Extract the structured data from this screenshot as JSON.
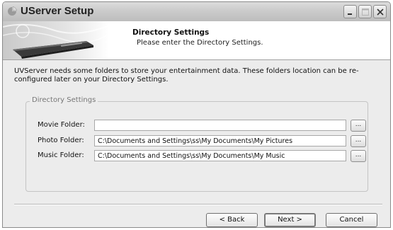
{
  "window": {
    "title": "UServer Setup"
  },
  "header": {
    "title": "Directory Settings",
    "subtitle": "Please enter the Directory Settings."
  },
  "intro": {
    "text": "UVServer needs some folders to store your entertainment data. These folders location can be re-configured later on your Directory Settings."
  },
  "group": {
    "legend": "Directory Settings",
    "fields": [
      {
        "label": "Movie Folder:",
        "value": "",
        "browse_label": "..."
      },
      {
        "label": "Photo Folder:",
        "value": "C:\\Documents and Settings\\ss\\My Documents\\My Pictures",
        "browse_label": "..."
      },
      {
        "label": "Music Folder:",
        "value": "C:\\Documents and Settings\\ss\\My Documents\\My Music",
        "browse_label": "..."
      }
    ]
  },
  "buttons": {
    "back": "< Back",
    "next": "Next >",
    "cancel": "Cancel"
  },
  "icons": {
    "app": "app-icon",
    "minimize": "minimize-icon",
    "maximize": "maximize-icon",
    "close": "close-icon",
    "header_art": "device-illustration-icon"
  }
}
